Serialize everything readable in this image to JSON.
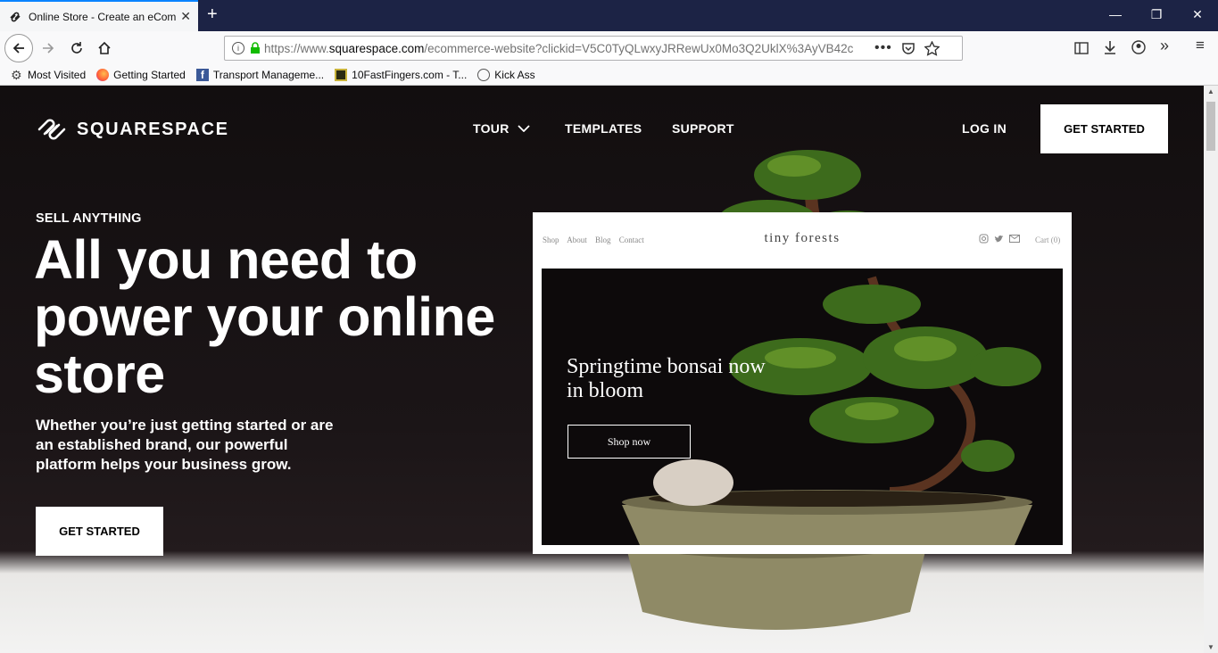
{
  "browser": {
    "tab_title": "Online Store - Create an eComm",
    "url_prefix": "https://www.",
    "url_domain": "squarespace.com",
    "url_rest": "/ecommerce-website?clickid=V5C0TyQLwxyJRRewUx0Mo3Q2UklX%3AyVB42c",
    "bookmarks": [
      {
        "label": "Most Visited",
        "icon": "gear-icon"
      },
      {
        "label": "Getting Started",
        "icon": "firefox-icon"
      },
      {
        "label": "Transport Manageme...",
        "icon": "facebook-icon"
      },
      {
        "label": "10FastFingers.com - T...",
        "icon": "site-icon"
      },
      {
        "label": "Kick Ass",
        "icon": "globe-icon"
      }
    ]
  },
  "site": {
    "logo": "SQUARESPACE",
    "nav": {
      "tour": "TOUR",
      "templates": "TEMPLATES",
      "support": "SUPPORT",
      "login": "LOG IN",
      "get_started": "GET STARTED"
    },
    "hero": {
      "eyebrow": "SELL ANYTHING",
      "headline": "All you need to power your online store",
      "subhead": "Whether you’re just getting started or are an established brand, our powerful platform helps your business grow.",
      "cta": "GET STARTED"
    },
    "mockup": {
      "nav": [
        "Shop",
        "About",
        "Blog",
        "Contact"
      ],
      "brand": "tiny forests",
      "cart": "Cart (0)",
      "title": "Springtime bonsai now in bloom",
      "button": "Shop now"
    }
  }
}
